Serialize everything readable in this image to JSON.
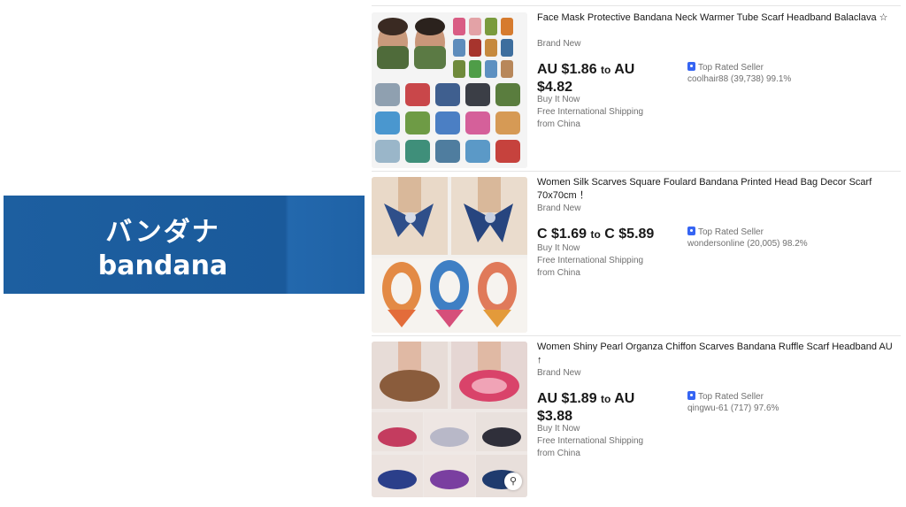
{
  "banner": {
    "japanese": "バンダナ",
    "english": "bandana"
  },
  "listings": [
    {
      "title": "Face Mask Protective Bandana Neck Warmer Tube Scarf Headband Balaclava ☆",
      "condition": "Brand New",
      "price_from": "AU $1.86",
      "price_to_word": "to",
      "price_to": "AU $4.82",
      "buy_format": "Buy It Now",
      "shipping": "Free International Shipping",
      "origin": "from China",
      "seller_badge": "Top Rated Seller",
      "seller_info": "coolhair88 (39,738) 99.1%"
    },
    {
      "title": "Women Silk Scarves Square Foulard Bandana Printed Head Bag Decor Scarf 70x70cm ！",
      "condition": "Brand New",
      "price_from": "C $1.69",
      "price_to_word": "to",
      "price_to": "C $5.89",
      "buy_format": "Buy It Now",
      "shipping": "Free International Shipping",
      "origin": "from China",
      "seller_badge": "Top Rated Seller",
      "seller_info": "wondersonline (20,005) 98.2%"
    },
    {
      "title": "Women Shiny Pearl Organza Chiffon Scarves Bandana Ruffle Scarf Headband AU ↑",
      "condition": "Brand New",
      "price_from": "AU $1.89",
      "price_to_word": "to",
      "price_to": "AU $3.88",
      "buy_format": "Buy It Now",
      "shipping": "Free International Shipping",
      "origin": "from China",
      "seller_badge": "Top Rated Seller",
      "seller_info": "qingwu-61 (717) 97.6%"
    }
  ],
  "colors": {
    "banner_blue": "#1d5fa0",
    "badge_blue": "#3665f3",
    "text": "#191919",
    "muted": "#707070"
  },
  "icons": {
    "seller_badge": "top-rated-seller-icon",
    "zoom": "magnify-icon"
  }
}
